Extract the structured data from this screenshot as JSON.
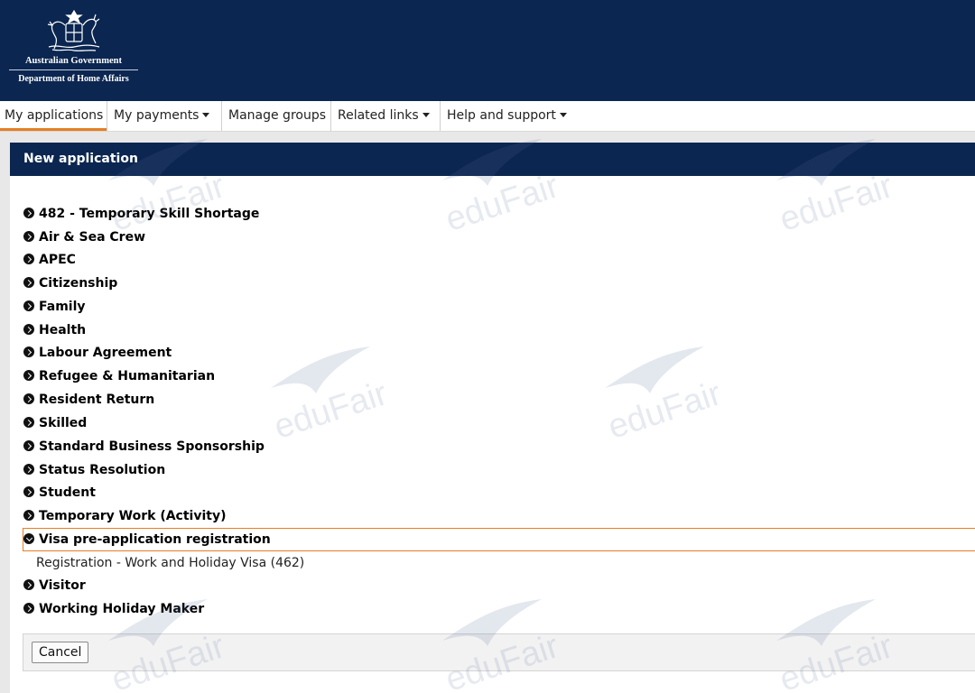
{
  "header": {
    "gov_name": "Australian Government",
    "department": "Department of Home Affairs"
  },
  "nav": {
    "items": [
      {
        "label": "My applications",
        "active": true,
        "dropdown": false
      },
      {
        "label": "My payments",
        "active": false,
        "dropdown": true
      },
      {
        "label": "Manage groups",
        "active": false,
        "dropdown": false
      },
      {
        "label": "Related links",
        "active": false,
        "dropdown": true
      },
      {
        "label": "Help and support",
        "active": false,
        "dropdown": true
      }
    ]
  },
  "panel": {
    "title": "New application",
    "categories": [
      {
        "label": "482 - Temporary Skill Shortage",
        "expanded": false
      },
      {
        "label": "Air & Sea Crew",
        "expanded": false
      },
      {
        "label": "APEC",
        "expanded": false
      },
      {
        "label": "Citizenship",
        "expanded": false
      },
      {
        "label": "Family",
        "expanded": false
      },
      {
        "label": "Health",
        "expanded": false
      },
      {
        "label": "Labour Agreement",
        "expanded": false
      },
      {
        "label": "Refugee & Humanitarian",
        "expanded": false
      },
      {
        "label": "Resident Return",
        "expanded": false
      },
      {
        "label": "Skilled",
        "expanded": false
      },
      {
        "label": "Standard Business Sponsorship",
        "expanded": false
      },
      {
        "label": "Status Resolution",
        "expanded": false
      },
      {
        "label": "Student",
        "expanded": false
      },
      {
        "label": "Temporary Work (Activity)",
        "expanded": false
      },
      {
        "label": "Visa pre-application registration",
        "expanded": true
      },
      {
        "label": "Visitor",
        "expanded": false
      },
      {
        "label": "Working Holiday Maker",
        "expanded": false
      }
    ],
    "subitem": "Registration - Work and Holiday Visa (462)"
  },
  "footer": {
    "cancel_label": "Cancel"
  },
  "watermark": {
    "text": "eduFair"
  },
  "colors": {
    "header_bg": "#0b2650",
    "accent": "#e67e22",
    "band": "#e8e8e8"
  }
}
